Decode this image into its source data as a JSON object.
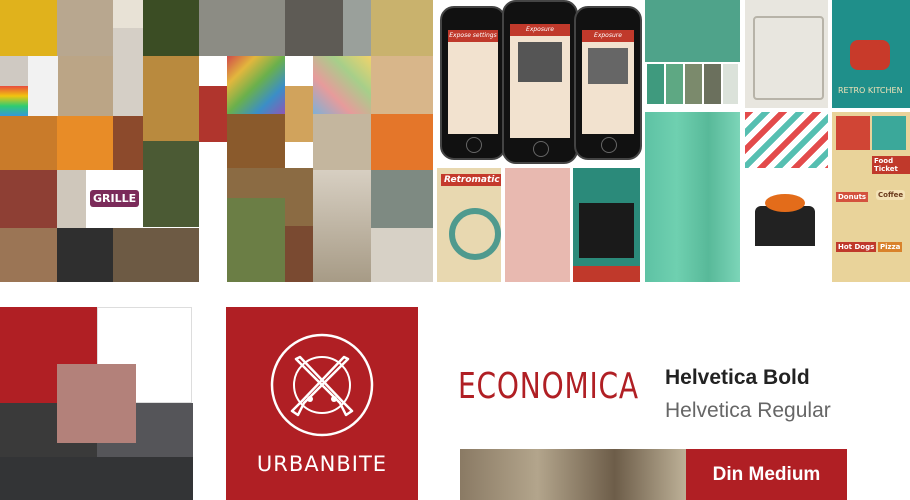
{
  "collage": {
    "tile_texts": {
      "grille": "GRILLE",
      "retro_kitchen": "RETRO KITCHEN",
      "retromatic": "Retromatic",
      "food_ticket": "Food Ticket",
      "coffee": "Coffee",
      "donuts": "Donuts",
      "hot_dogs": "Hot Dogs",
      "pizza": "Pizza"
    },
    "palette_colors": [
      "#3f9a7e",
      "#5ea883",
      "#7b8a6c",
      "#6b705d",
      "#dbe2da"
    ]
  },
  "phones": [
    {
      "header": "Expose settings"
    },
    {
      "header": "Exposure"
    },
    {
      "header": "Exposure"
    }
  ],
  "brand": {
    "name": "URBANBITE",
    "primary_color": "#b01f24",
    "swatch_colors": [
      "#b01f24",
      "#ffffff",
      "#b3817a",
      "#3a3a3a",
      "#555559",
      "#333436"
    ]
  },
  "typography": {
    "display": "ECONOMICA",
    "bold": "Helvetica Bold",
    "regular": "Helvetica Regular",
    "medium": "Din Medium"
  }
}
